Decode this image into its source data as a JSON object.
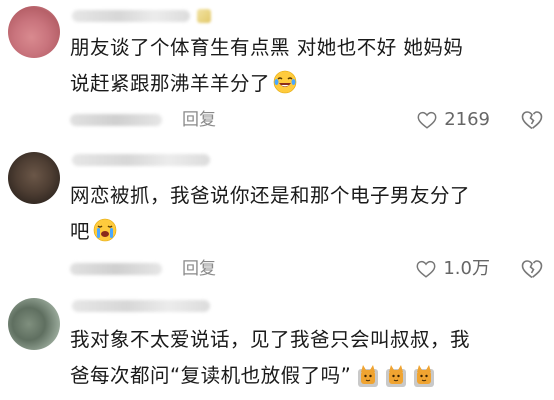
{
  "comments": [
    {
      "text_lines": [
        "朋友谈了个体育生有点黑  对她也不好  她妈妈",
        "说赶紧跟那沸羊羊分了"
      ],
      "reply_label": "回复",
      "likes": "2169"
    },
    {
      "text_lines": [
        "网恋被抓，我爸说你还是和那个电子男友分了",
        "吧"
      ],
      "reply_label": "回复",
      "likes": "1.0万"
    },
    {
      "text_lines": [
        "我对象不太爱说话，见了我爸只会叫叔叔，我",
        "爸每次都问“复读机也放假了吗”"
      ]
    }
  ]
}
